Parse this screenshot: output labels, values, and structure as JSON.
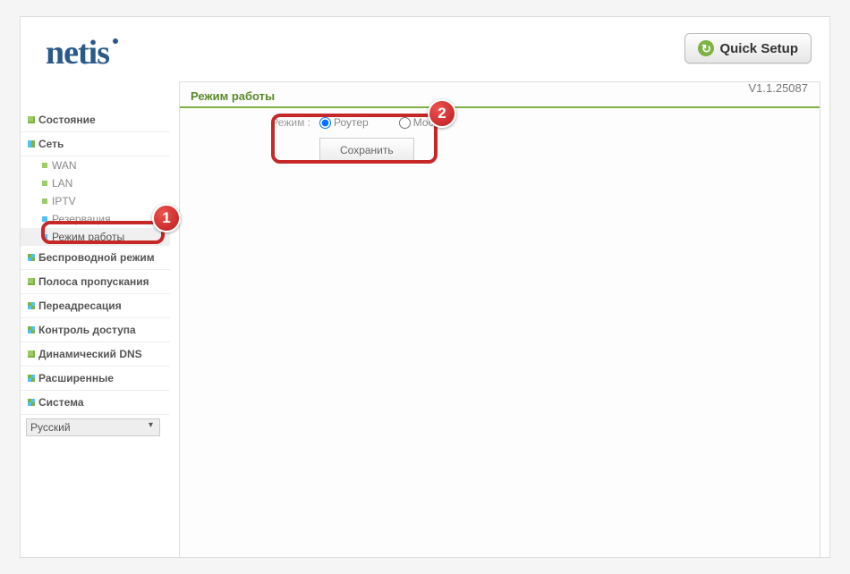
{
  "header": {
    "logo": "netis",
    "quick_setup": "Quick Setup"
  },
  "version": "V1.1.25087",
  "sidebar": {
    "items": [
      {
        "label": "Состояние",
        "icon": "green"
      },
      {
        "label": "Сеть",
        "icon": "blue-split"
      },
      {
        "label": "Беспроводной режим",
        "icon": "quad"
      },
      {
        "label": "Полоса пропускания",
        "icon": "green"
      },
      {
        "label": "Переадресация",
        "icon": "quad"
      },
      {
        "label": "Контроль доступа",
        "icon": "quad"
      },
      {
        "label": "Динамический DNS",
        "icon": "green"
      },
      {
        "label": "Расширенные",
        "icon": "quad"
      },
      {
        "label": "Система",
        "icon": "quad"
      }
    ],
    "net_sub": [
      {
        "label": "WAN",
        "icon": "green"
      },
      {
        "label": "LAN",
        "icon": "green"
      },
      {
        "label": "IPTV",
        "icon": "green"
      },
      {
        "label": "Резервация ...",
        "icon": "blue"
      },
      {
        "label": "Режим работы",
        "icon": "blue",
        "active": true
      }
    ],
    "language": "Русский"
  },
  "content": {
    "title": "Режим работы",
    "mode_label": "Режим :",
    "opt_router": "Роутер",
    "opt_bridge": "Мост",
    "save": "Сохранить"
  },
  "annotations": {
    "badge1": "1",
    "badge2": "2"
  }
}
